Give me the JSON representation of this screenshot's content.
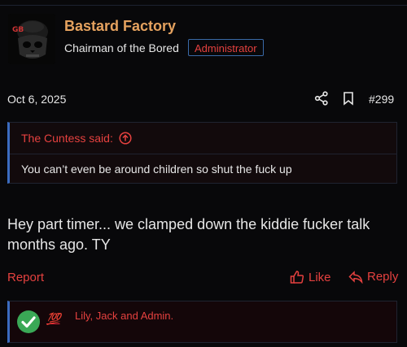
{
  "user": {
    "name": "Bastard Factory",
    "title": "Chairman of the Bored",
    "badge": "Administrator"
  },
  "post": {
    "date": "Oct 6, 2025",
    "number": "#299",
    "quote": {
      "author_line": "The Cuntess said:",
      "text": "You can’t even be around children so shut the fuck up"
    },
    "body": "Hey part timer... we clamped down the kiddie fucker talk months ago. TY"
  },
  "actions": {
    "report": "Report",
    "like": "Like",
    "reply": "Reply"
  },
  "reactions": {
    "emoji_text": "💯",
    "names": "Lily, Jack and Admin."
  },
  "colors": {
    "accent": "#e5413f",
    "username": "#e5a25f",
    "quote_border": "#3b6cc0",
    "background": "#08080a"
  },
  "icons": [
    "avatar-skull",
    "share-icon",
    "bookmark-icon",
    "arrow-up-circle-icon",
    "thumbs-up-icon",
    "reply-icon",
    "checkmark-icon",
    "hundred-points-icon"
  ]
}
